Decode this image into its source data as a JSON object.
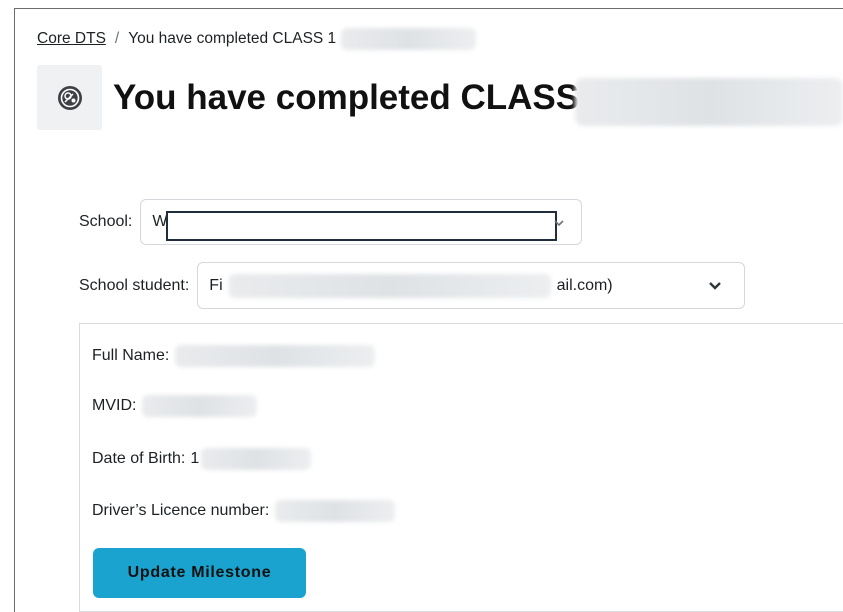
{
  "breadcrumb": {
    "root": "Core DTS",
    "separator": "/",
    "current": "You have completed CLASS 1"
  },
  "page": {
    "title": "You have completed CLASS 1",
    "icon": "badge-icon"
  },
  "form": {
    "school_label": "School:",
    "school_value": "W",
    "student_label": "School student:",
    "student_value_start": "Fi",
    "student_value_end": "ail.com)"
  },
  "details": {
    "full_name_label": "Full Name:",
    "mvid_label": "MVID:",
    "dob_label": "Date of Birth:",
    "dob_value_start": "1",
    "licence_label": "Driver’s Licence number:"
  },
  "actions": {
    "update_label": "Update Milestone"
  },
  "colors": {
    "button_bg": "#1aa3ce",
    "focus_border": "#1f2d3d"
  }
}
